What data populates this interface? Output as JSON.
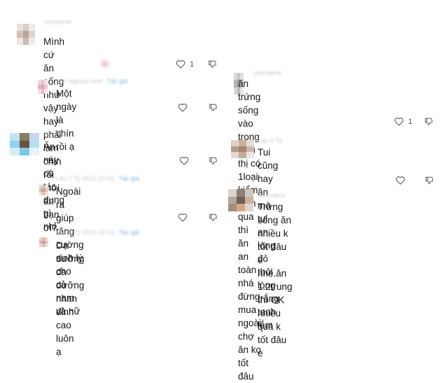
{
  "comments": [
    {
      "author": "username",
      "text_lines": [
        "Mình cứ ăn sống như vậy hay phải làm chín",
        "rồi mới ăn bạn ơi?"
      ],
      "like_count": "1"
    },
    {
      "author": "Van Nguyen Anh",
      "badge": "Tác giả",
      "text_lines": [
        "Một ngày là chín rồi ạ"
      ]
    },
    {
      "author": "ha Thuỷ",
      "text_lines": [
        "Ăn này có tác dụng gì nhỉ"
      ]
    },
    {
      "author": "Lâu 7 Tỷ 2023-10-01",
      "badge": "Tác giả",
      "text_lines": [
        "Ngoài ra giúp tăng cường sinh lý cho cả",
        "nam và nữ"
      ]
    },
    {
      "author": "Lâu 7 Tỷ 2023-10-01",
      "badge": "Tác giả",
      "text_lines": [
        "Dạ dưỡng da dưỡng nhan đỉnh cao luôn",
        "ạ"
      ]
    },
    {
      "author": "username",
      "text_lines": [
        "ăn trứng sống vào trong siêu thị có 1loại",
        "kiểm định qua thì ăn an toàn nhá đừng mua",
        "ngoài chợ ăn ko tốt đâu"
      ],
      "like_count": "1"
    },
    {
      "author": "Lâu 2 Tỷ",
      "text_lines": [
        "Tui cũng hay ăn mà tui an lòng đỏ thôi lòng",
        "trắng tanh lắm"
      ]
    },
    {
      "author": "username",
      "text_lines": [
        "Trứng sống ăn nhiều k tốt đâu e nhé.ăn",
        "1.2trung thì OK nhiều quá k tốt đâu e"
      ]
    }
  ],
  "icons": {
    "like": "heart-outline-icon",
    "dislike": "thumbs-down-icon"
  },
  "colors": {
    "text": "#161616",
    "meta": "#c9c9c9",
    "badge": "#7fb6dc",
    "icon": "#666666"
  }
}
